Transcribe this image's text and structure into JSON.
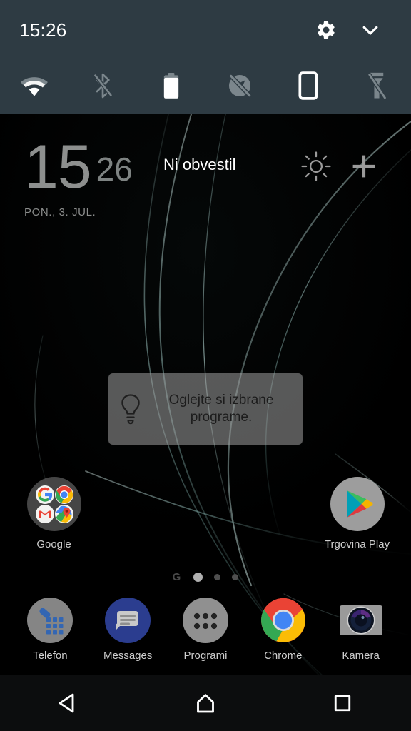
{
  "statusbar": {
    "time": "15:26",
    "actions": [
      {
        "name": "settings-gear-icon",
        "label": "Nastavitve"
      },
      {
        "name": "collapse-chevron-icon",
        "label": "Skrij"
      }
    ]
  },
  "quick_settings": {
    "tiles": [
      {
        "name": "wifi-icon",
        "label": "Wi-Fi",
        "state": "on"
      },
      {
        "name": "bluetooth-off-icon",
        "label": "Bluetooth",
        "state": "off"
      },
      {
        "name": "battery-icon",
        "label": "Baterija",
        "state": "on"
      },
      {
        "name": "location-off-icon",
        "label": "Lokacija",
        "state": "off"
      },
      {
        "name": "auto-rotate-icon",
        "label": "Samodejno sukanje",
        "state": "on"
      },
      {
        "name": "flashlight-off-icon",
        "label": "Svetilka",
        "state": "off"
      }
    ]
  },
  "clock_widget": {
    "hour": "15",
    "minute": "26",
    "date": "PON., 3. JUL.",
    "notification_text": "Ni obvestil",
    "weather_icon": "sun-icon",
    "add_icon": "plus-icon"
  },
  "tooltip": {
    "icon": "lightbulb-icon",
    "text": "Oglejte si izbrane programe."
  },
  "homescreen": {
    "apps": [
      {
        "label": "Google",
        "icon": "google-folder-icon"
      },
      {
        "label": "Trgovina Play",
        "icon": "play-store-icon"
      }
    ]
  },
  "page_indicator": {
    "google_glyph": "G",
    "pages": 3,
    "active_index": 0
  },
  "dock": {
    "items": [
      {
        "label": "Telefon",
        "icon": "phone-icon"
      },
      {
        "label": "Messages",
        "icon": "messages-icon"
      },
      {
        "label": "Programi",
        "icon": "app-drawer-icon"
      },
      {
        "label": "Chrome",
        "icon": "chrome-icon"
      },
      {
        "label": "Kamera",
        "icon": "camera-icon"
      }
    ]
  },
  "navbar": {
    "buttons": [
      {
        "name": "nav-back-button",
        "label": "Nazaj"
      },
      {
        "name": "nav-home-button",
        "label": "Domov"
      },
      {
        "name": "nav-recents-button",
        "label": "Nedavno"
      }
    ]
  },
  "colors": {
    "panel_bg": "#2e3b43",
    "navbar_bg": "#0c0d0e",
    "wallpaper_bg": "#000000",
    "accent_line": "#6f9a97",
    "icon_on": "#ffffff",
    "icon_off": "#7b868c",
    "label": "#cfcfcf"
  }
}
